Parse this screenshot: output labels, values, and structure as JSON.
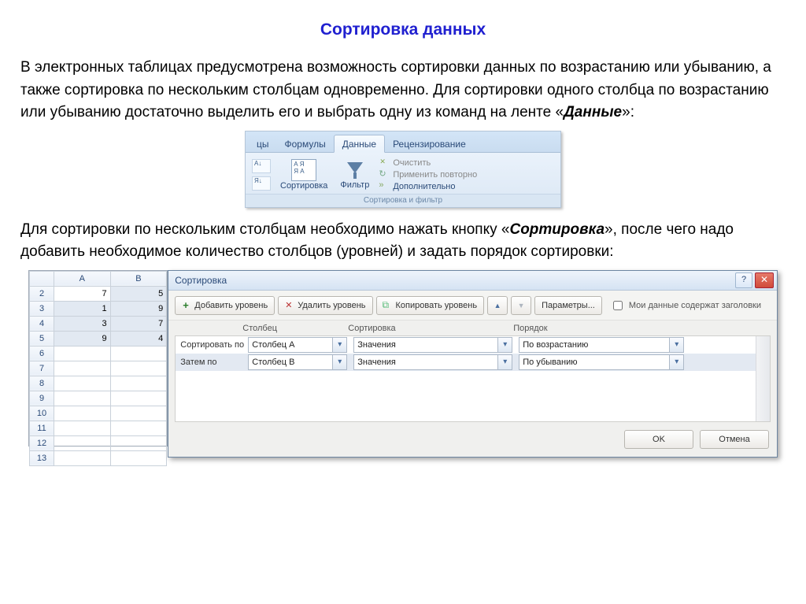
{
  "title": "Сортировка данных",
  "para1_pre": "В электронных таблицах предусмотрена возможность сортировки данных по возрастанию или убыванию, а также сортировка по нескольким столбцам одновременно. Для сортировки одного столбца по возрастанию или убыванию достаточно выделить его и выбрать одну из команд на ленте «",
  "para1_em": "Данные",
  "para1_post": "»:",
  "para2_pre": "Для сортировки по нескольким столбцам необходимо нажать кнопку «",
  "para2_em": "Сортировка",
  "para2_post": "», после чего надо добавить необходимое количество столбцов  (уровней) и задать порядок сортировки:",
  "ribbon": {
    "tabs": {
      "t0": "цы",
      "t1": "Формулы",
      "t2": "Данные",
      "t3": "Рецензирование"
    },
    "asc_short": "А↓",
    "desc_short": "Я↓",
    "sort_btn": "Сортировка",
    "filter_btn": "Фильтр",
    "clear": "Очистить",
    "reapply": "Применить повторно",
    "advanced": "Дополнительно",
    "group_caption": "Сортировка и фильтр"
  },
  "sheet": {
    "cols": {
      "a": "A",
      "b": "B"
    },
    "rows": {
      "r2": {
        "n": "2",
        "a": "7",
        "b": "5"
      },
      "r3": {
        "n": "3",
        "a": "1",
        "b": "9"
      },
      "r4": {
        "n": "4",
        "a": "3",
        "b": "7"
      },
      "r5": {
        "n": "5",
        "a": "9",
        "b": "4"
      },
      "r6": {
        "n": "6"
      },
      "r7": {
        "n": "7"
      },
      "r8": {
        "n": "8"
      },
      "r9": {
        "n": "9"
      },
      "r10": {
        "n": "10"
      },
      "r11": {
        "n": "11"
      },
      "r12": {
        "n": "12"
      },
      "r13": {
        "n": "13"
      }
    }
  },
  "dialog": {
    "title": "Сортировка",
    "help": "?",
    "add_level": "Добавить уровень",
    "del_level": "Удалить уровень",
    "copy_level": "Копировать уровень",
    "params": "Параметры...",
    "has_headers": "Мои данные содержат заголовки",
    "hdr_column": "Столбец",
    "hdr_sort": "Сортировка",
    "hdr_order": "Порядок",
    "rows": {
      "r0": {
        "label": "Сортировать по",
        "col": "Столбец A",
        "sort": "Значения",
        "order": "По возрастанию"
      },
      "r1": {
        "label": "Затем по",
        "col": "Столбец B",
        "sort": "Значения",
        "order": "По убыванию"
      }
    },
    "ok": "OK",
    "cancel": "Отмена"
  }
}
